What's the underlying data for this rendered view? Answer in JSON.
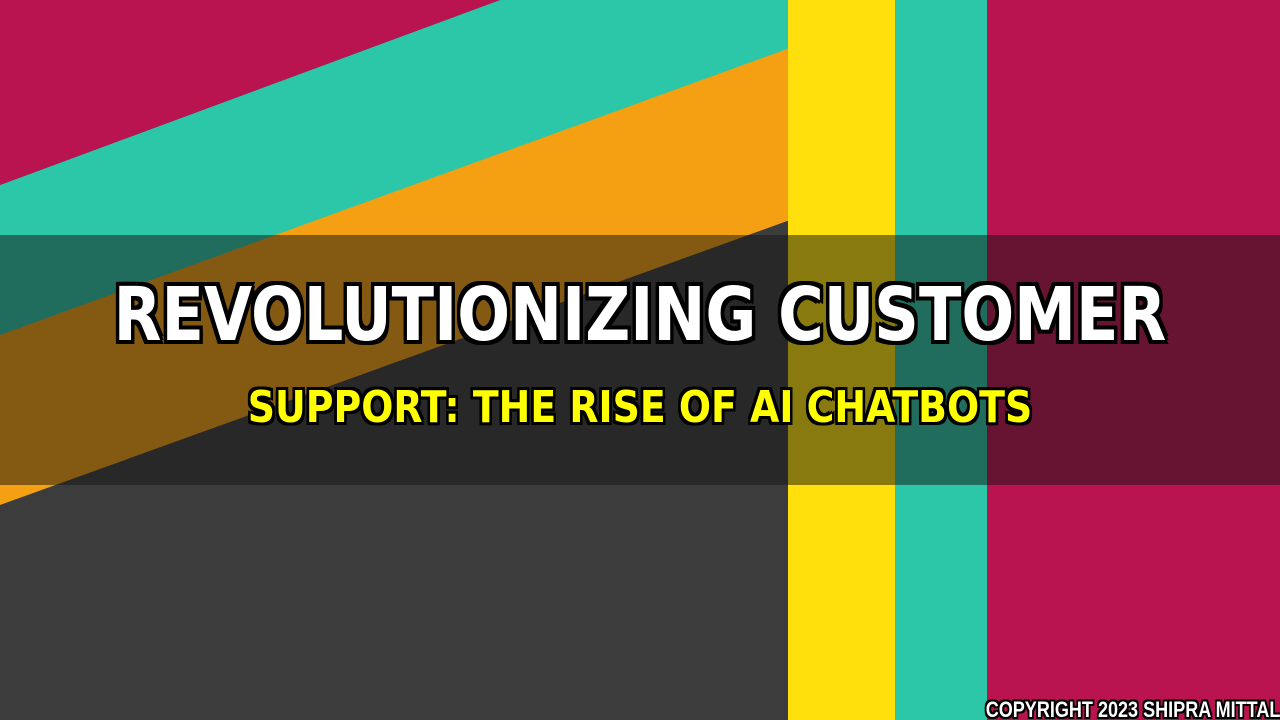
{
  "colors": {
    "magenta": "#b9144f",
    "teal": "#2cc6a8",
    "orange": "#f4a012",
    "yellow": "#ffe00c",
    "dark_gray": "#3c3c3c",
    "band_overlay": "rgba(20,20,20,0.5)",
    "title_text": "#ffffff",
    "subtitle_text": "#ffff00"
  },
  "title": {
    "line1": "REVOLUTIONIZING CUSTOMER",
    "line2": "SUPPORT: THE RISE OF AI CHATBOTS"
  },
  "copyright": "COPYRIGHT 2023 SHIPRA MITTAL"
}
